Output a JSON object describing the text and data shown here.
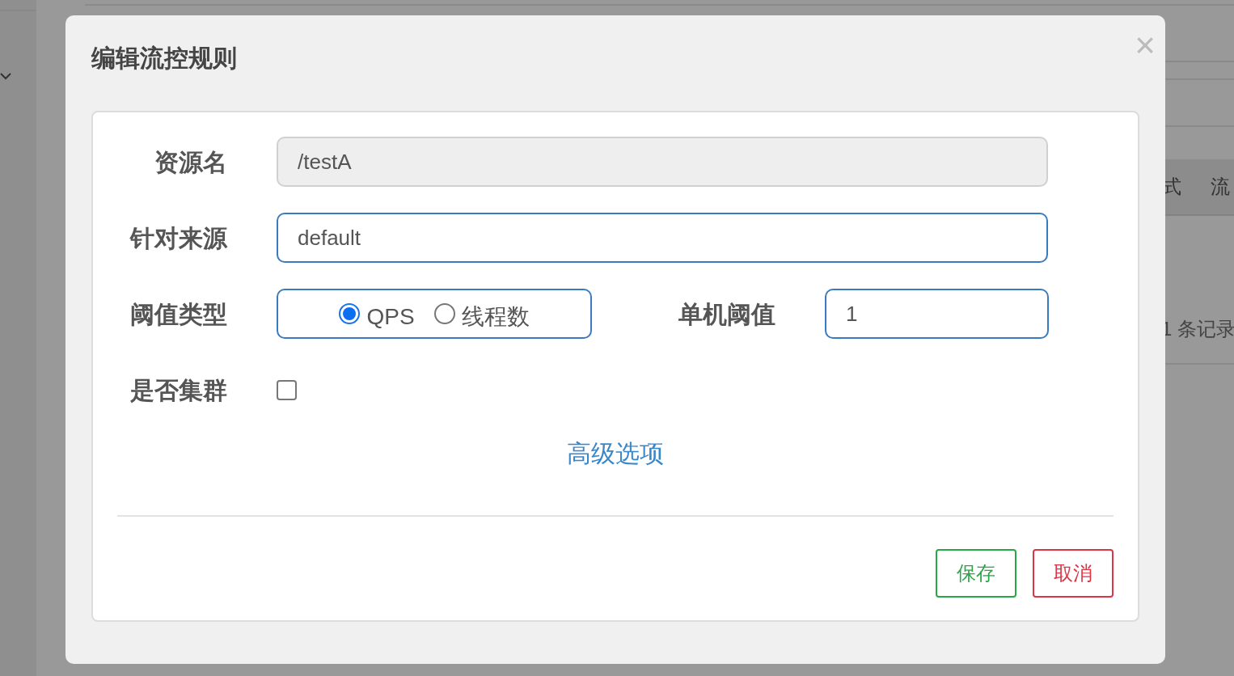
{
  "background": {
    "table_header": [
      "式",
      "流"
    ],
    "record_count": "1 条记录"
  },
  "dialog": {
    "title": "编辑流控规则",
    "close": "×",
    "rows": [
      {
        "fields": [
          {
            "kind": "text",
            "label": "资源名",
            "value": "/testA",
            "disabled": true
          }
        ]
      },
      {
        "fields": [
          {
            "kind": "text",
            "label": "针对来源",
            "value": "default",
            "disabled": false
          }
        ]
      },
      {
        "fields": [
          {
            "kind": "radio",
            "label": "阈值类型",
            "options": [
              {
                "label": "QPS",
                "selected": true
              },
              {
                "label": "线程数",
                "selected": false
              }
            ]
          },
          {
            "kind": "text",
            "label": "单机阈值",
            "value": "1",
            "disabled": false
          }
        ]
      },
      {
        "fields": [
          {
            "kind": "checkbox",
            "label": "是否集群",
            "checked": false
          }
        ]
      }
    ],
    "advanced_link": "高级选项",
    "buttons": [
      {
        "label": "保存",
        "kind": "save"
      },
      {
        "label": "取消",
        "kind": "cancel"
      }
    ]
  }
}
